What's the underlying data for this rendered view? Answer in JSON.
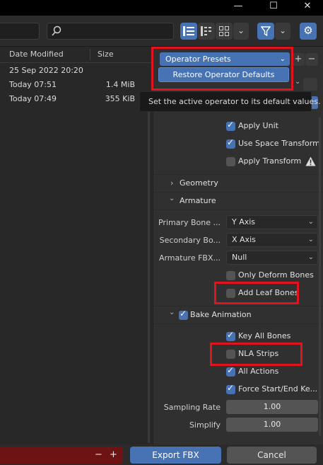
{
  "window": {
    "minimize_glyph": "—",
    "maximize_glyph": "☐",
    "close_glyph": "✕"
  },
  "toolbar": {
    "filter_glyph": "⊽",
    "chevron_glyph": "⌄",
    "settings_glyph": "⚙"
  },
  "filelist": {
    "columns": [
      "Date Modified",
      "Size"
    ],
    "rows": [
      {
        "date": "25 Sep 2022 20:20",
        "size": ""
      },
      {
        "date": "Today 07:51",
        "size": "1.4 MiB"
      },
      {
        "date": "Today 07:49",
        "size": "355 KiB"
      }
    ]
  },
  "panel": {
    "operator_presets_label": "Operator Presets",
    "restore_defaults_label": "Restore Operator Defaults",
    "tooltip": "Set the active operator to its default values.",
    "transform": {
      "apply_unit": {
        "label": "Apply Unit",
        "checked": true
      },
      "use_space_transform": {
        "label": "Use Space Transform",
        "checked": true
      },
      "apply_transform": {
        "label": "Apply Transform",
        "checked": false
      }
    },
    "geometry_label": "Geometry",
    "armature_label": "Armature",
    "armature": {
      "primary_bone_label": "Primary Bone ...",
      "primary_bone_value": "Y Axis",
      "secondary_bone_label": "Secondary Bo...",
      "secondary_bone_value": "X Axis",
      "fbx_node_label": "Armature FBX...",
      "fbx_node_value": "Null",
      "only_deform_bones": {
        "label": "Only Deform Bones",
        "checked": false
      },
      "add_leaf_bones": {
        "label": "Add Leaf Bones",
        "checked": false
      }
    },
    "bake_animation": {
      "label": "Bake Animation",
      "checked": true,
      "key_all_bones": {
        "label": "Key All Bones",
        "checked": true
      },
      "nla_strips": {
        "label": "NLA Strips",
        "checked": false
      },
      "all_actions": {
        "label": "All Actions",
        "checked": true
      },
      "force_start_end": {
        "label": "Force Start/End Ke...",
        "checked": true
      },
      "sampling_rate_label": "Sampling Rate",
      "sampling_rate_value": "1.00",
      "simplify_label": "Simplify",
      "simplify_value": "1.00"
    }
  },
  "bottom": {
    "minus_glyph": "−",
    "plus_glyph": "+",
    "export_label": "Export FBX",
    "cancel_label": "Cancel"
  },
  "colors": {
    "accent": "#4772b3",
    "highlight": "#e0141e",
    "error_bar": "#6e1313"
  }
}
